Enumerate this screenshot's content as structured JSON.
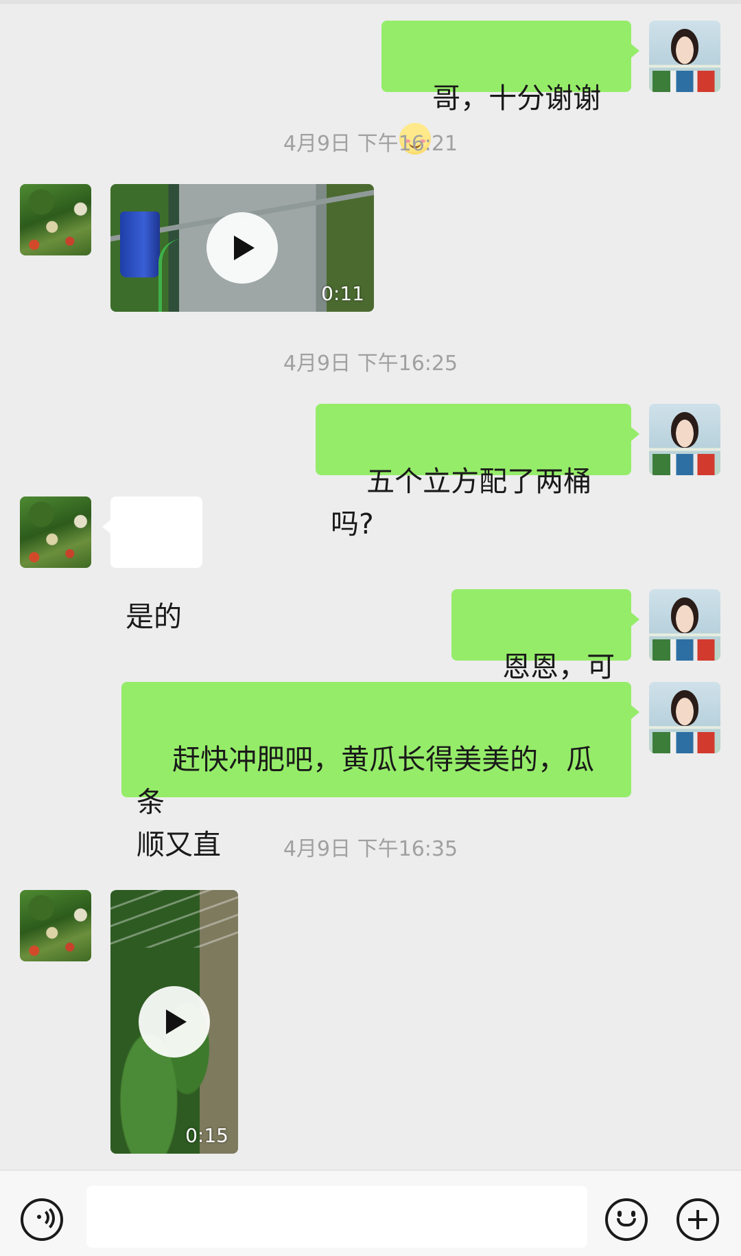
{
  "chat": {
    "messages": [
      {
        "side": "me",
        "text": "哥，十分谢谢",
        "emoji": "smiling-face-emoji"
      },
      {
        "timestamp": "4月9日 下午16:21"
      },
      {
        "side": "friend",
        "type": "video",
        "duration": "0:11"
      },
      {
        "timestamp": "4月9日 下午16:25"
      },
      {
        "side": "me",
        "text": "五个立方配了两桶吗?"
      },
      {
        "side": "friend",
        "text": "是的"
      },
      {
        "side": "me",
        "text": "恩恩，可以"
      },
      {
        "side": "me",
        "text": "赶快冲肥吧，黄瓜长得美美的，瓜条\n顺又直"
      },
      {
        "timestamp": "4月9日 下午16:35"
      },
      {
        "side": "friend",
        "type": "video",
        "duration": "0:15"
      }
    ]
  },
  "input_bar": {
    "icons": [
      "voice-icon",
      "emoji-icon",
      "plus-icon"
    ],
    "placeholder": ""
  },
  "colors": {
    "background": "#ededed",
    "my_bubble": "#95ec69",
    "friend_bubble": "#ffffff",
    "timestamp_text": "#a0a0a0"
  }
}
